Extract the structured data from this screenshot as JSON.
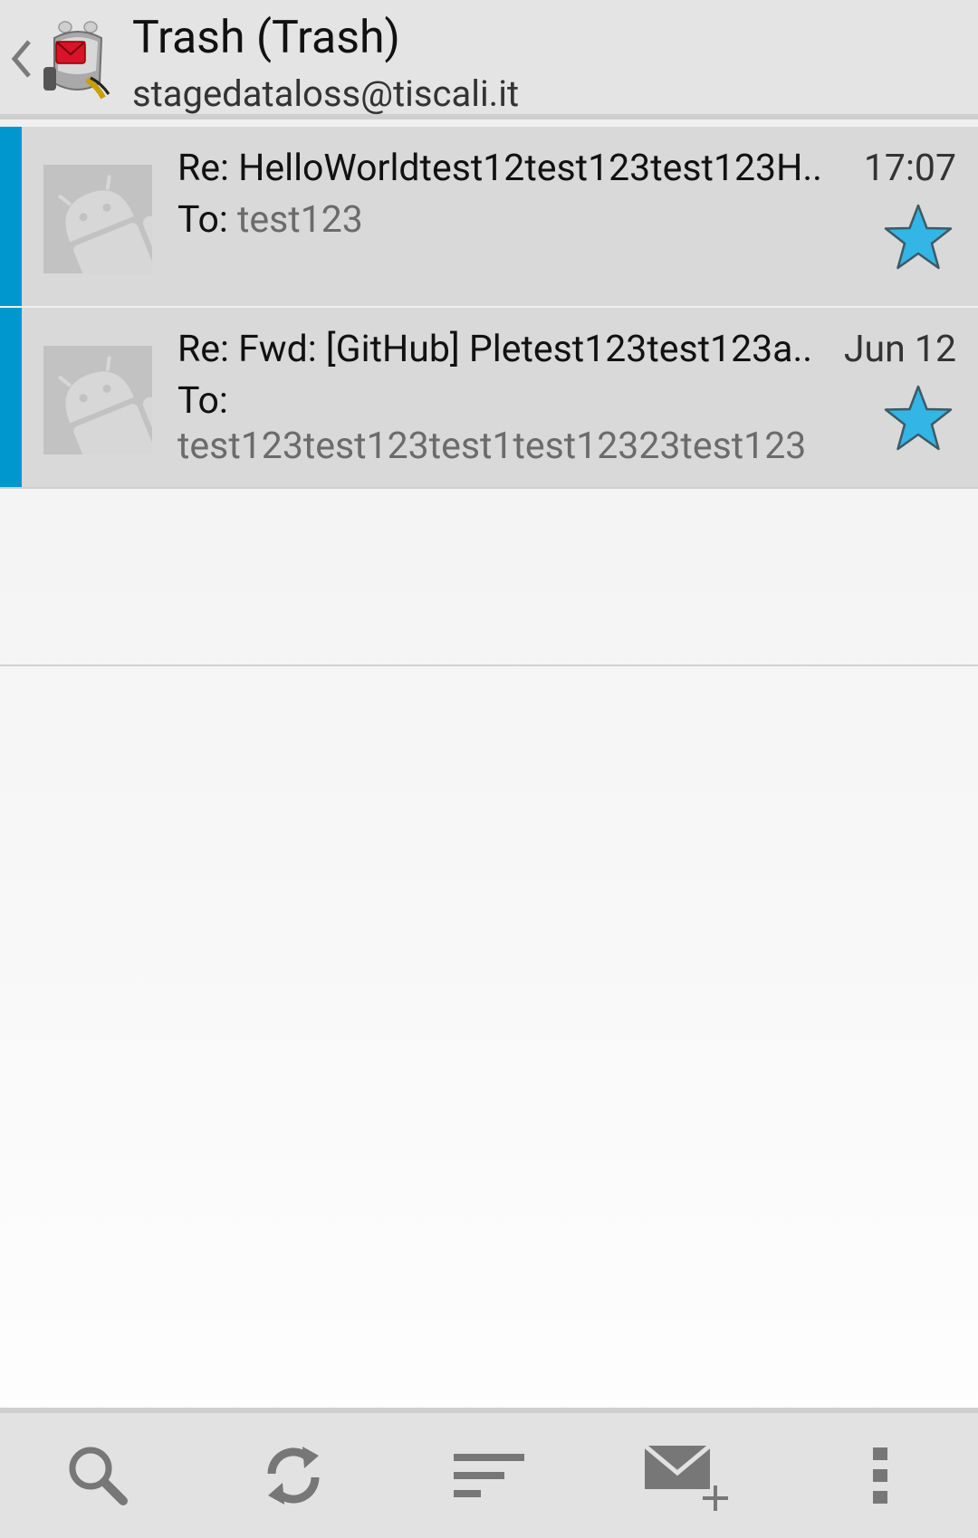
{
  "header": {
    "folder_title": "Trash (Trash)",
    "account_email": "stagedataloss@tiscali.it",
    "back_icon": "chevron-left-icon",
    "app_icon": "k9-mail-logo-icon"
  },
  "messages": [
    {
      "subject": "Re: HelloWorldtest12test123test123H..",
      "date": "17:07",
      "to_label": "To:",
      "to_value": "test123",
      "starred": true,
      "unread": true
    },
    {
      "subject": "Re: Fwd: [GitHub] Pletest123test123a..",
      "date": "Jun 12",
      "to_label": "To:",
      "to_value": "test123test123test1test12323test123",
      "starred": true,
      "unread": true
    }
  ],
  "toolbar": {
    "items": [
      "search-icon",
      "refresh-icon",
      "sort-icon",
      "compose-icon",
      "overflow-menu-icon"
    ]
  },
  "colors": {
    "accent": "#0097cf",
    "star": "#33b5e5",
    "header_bg": "#e4e4e4",
    "row_bg": "#d9d9d9"
  }
}
